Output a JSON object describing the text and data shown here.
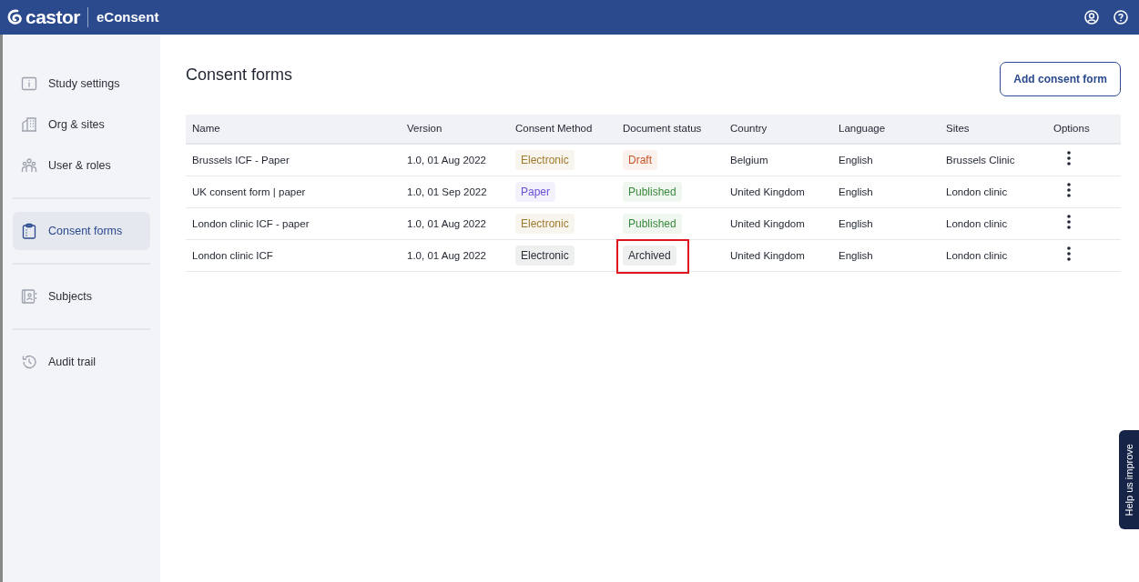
{
  "header": {
    "logo": "castor",
    "product": "eConsent"
  },
  "sidebar": {
    "items": [
      {
        "label": "Study settings",
        "selected": false
      },
      {
        "label": "Org & sites",
        "selected": false
      },
      {
        "label": "User & roles",
        "selected": false
      },
      {
        "label": "Consent forms",
        "selected": true
      },
      {
        "label": "Subjects",
        "selected": false
      },
      {
        "label": "Audit trail",
        "selected": false
      }
    ]
  },
  "page": {
    "title": "Consent forms",
    "add_button": "Add consent form"
  },
  "table": {
    "columns": [
      "Name",
      "Version",
      "Consent Method",
      "Document status",
      "Country",
      "Language",
      "Sites",
      "Options"
    ],
    "rows": [
      {
        "name": "Brussels ICF - Paper",
        "version": "1.0, 01 Aug 2022",
        "method": {
          "text": "Electronic",
          "color": "#a07a2c"
        },
        "status": {
          "text": "Draft",
          "color": "#c8542a"
        },
        "country": "Belgium",
        "language": "English",
        "sites": "Brussels Clinic",
        "highlighted": false
      },
      {
        "name": "UK consent form | paper",
        "version": "1.0, 01 Sep 2022",
        "method": {
          "text": "Paper",
          "color": "#6a4fd8"
        },
        "status": {
          "text": "Published",
          "color": "#3a8a3c"
        },
        "country": "United Kingdom",
        "language": "English",
        "sites": "London clinic",
        "highlighted": false
      },
      {
        "name": "London clinic ICF - paper",
        "version": "1.0, 01 Aug 2022",
        "method": {
          "text": "Electronic",
          "color": "#a07a2c"
        },
        "status": {
          "text": "Published",
          "color": "#3a8a3c"
        },
        "country": "United Kingdom",
        "language": "English",
        "sites": "London clinic",
        "highlighted": false
      },
      {
        "name": "London clinic ICF",
        "version": "1.0, 01 Aug 2022",
        "method": {
          "text": "Electronic",
          "color": "#2b2f38"
        },
        "status": {
          "text": "Archived",
          "color": "#2b2f38"
        },
        "country": "United Kingdom",
        "language": "English",
        "sites": "London clinic",
        "highlighted": true
      }
    ]
  },
  "feedback_tab": "Help us improve"
}
